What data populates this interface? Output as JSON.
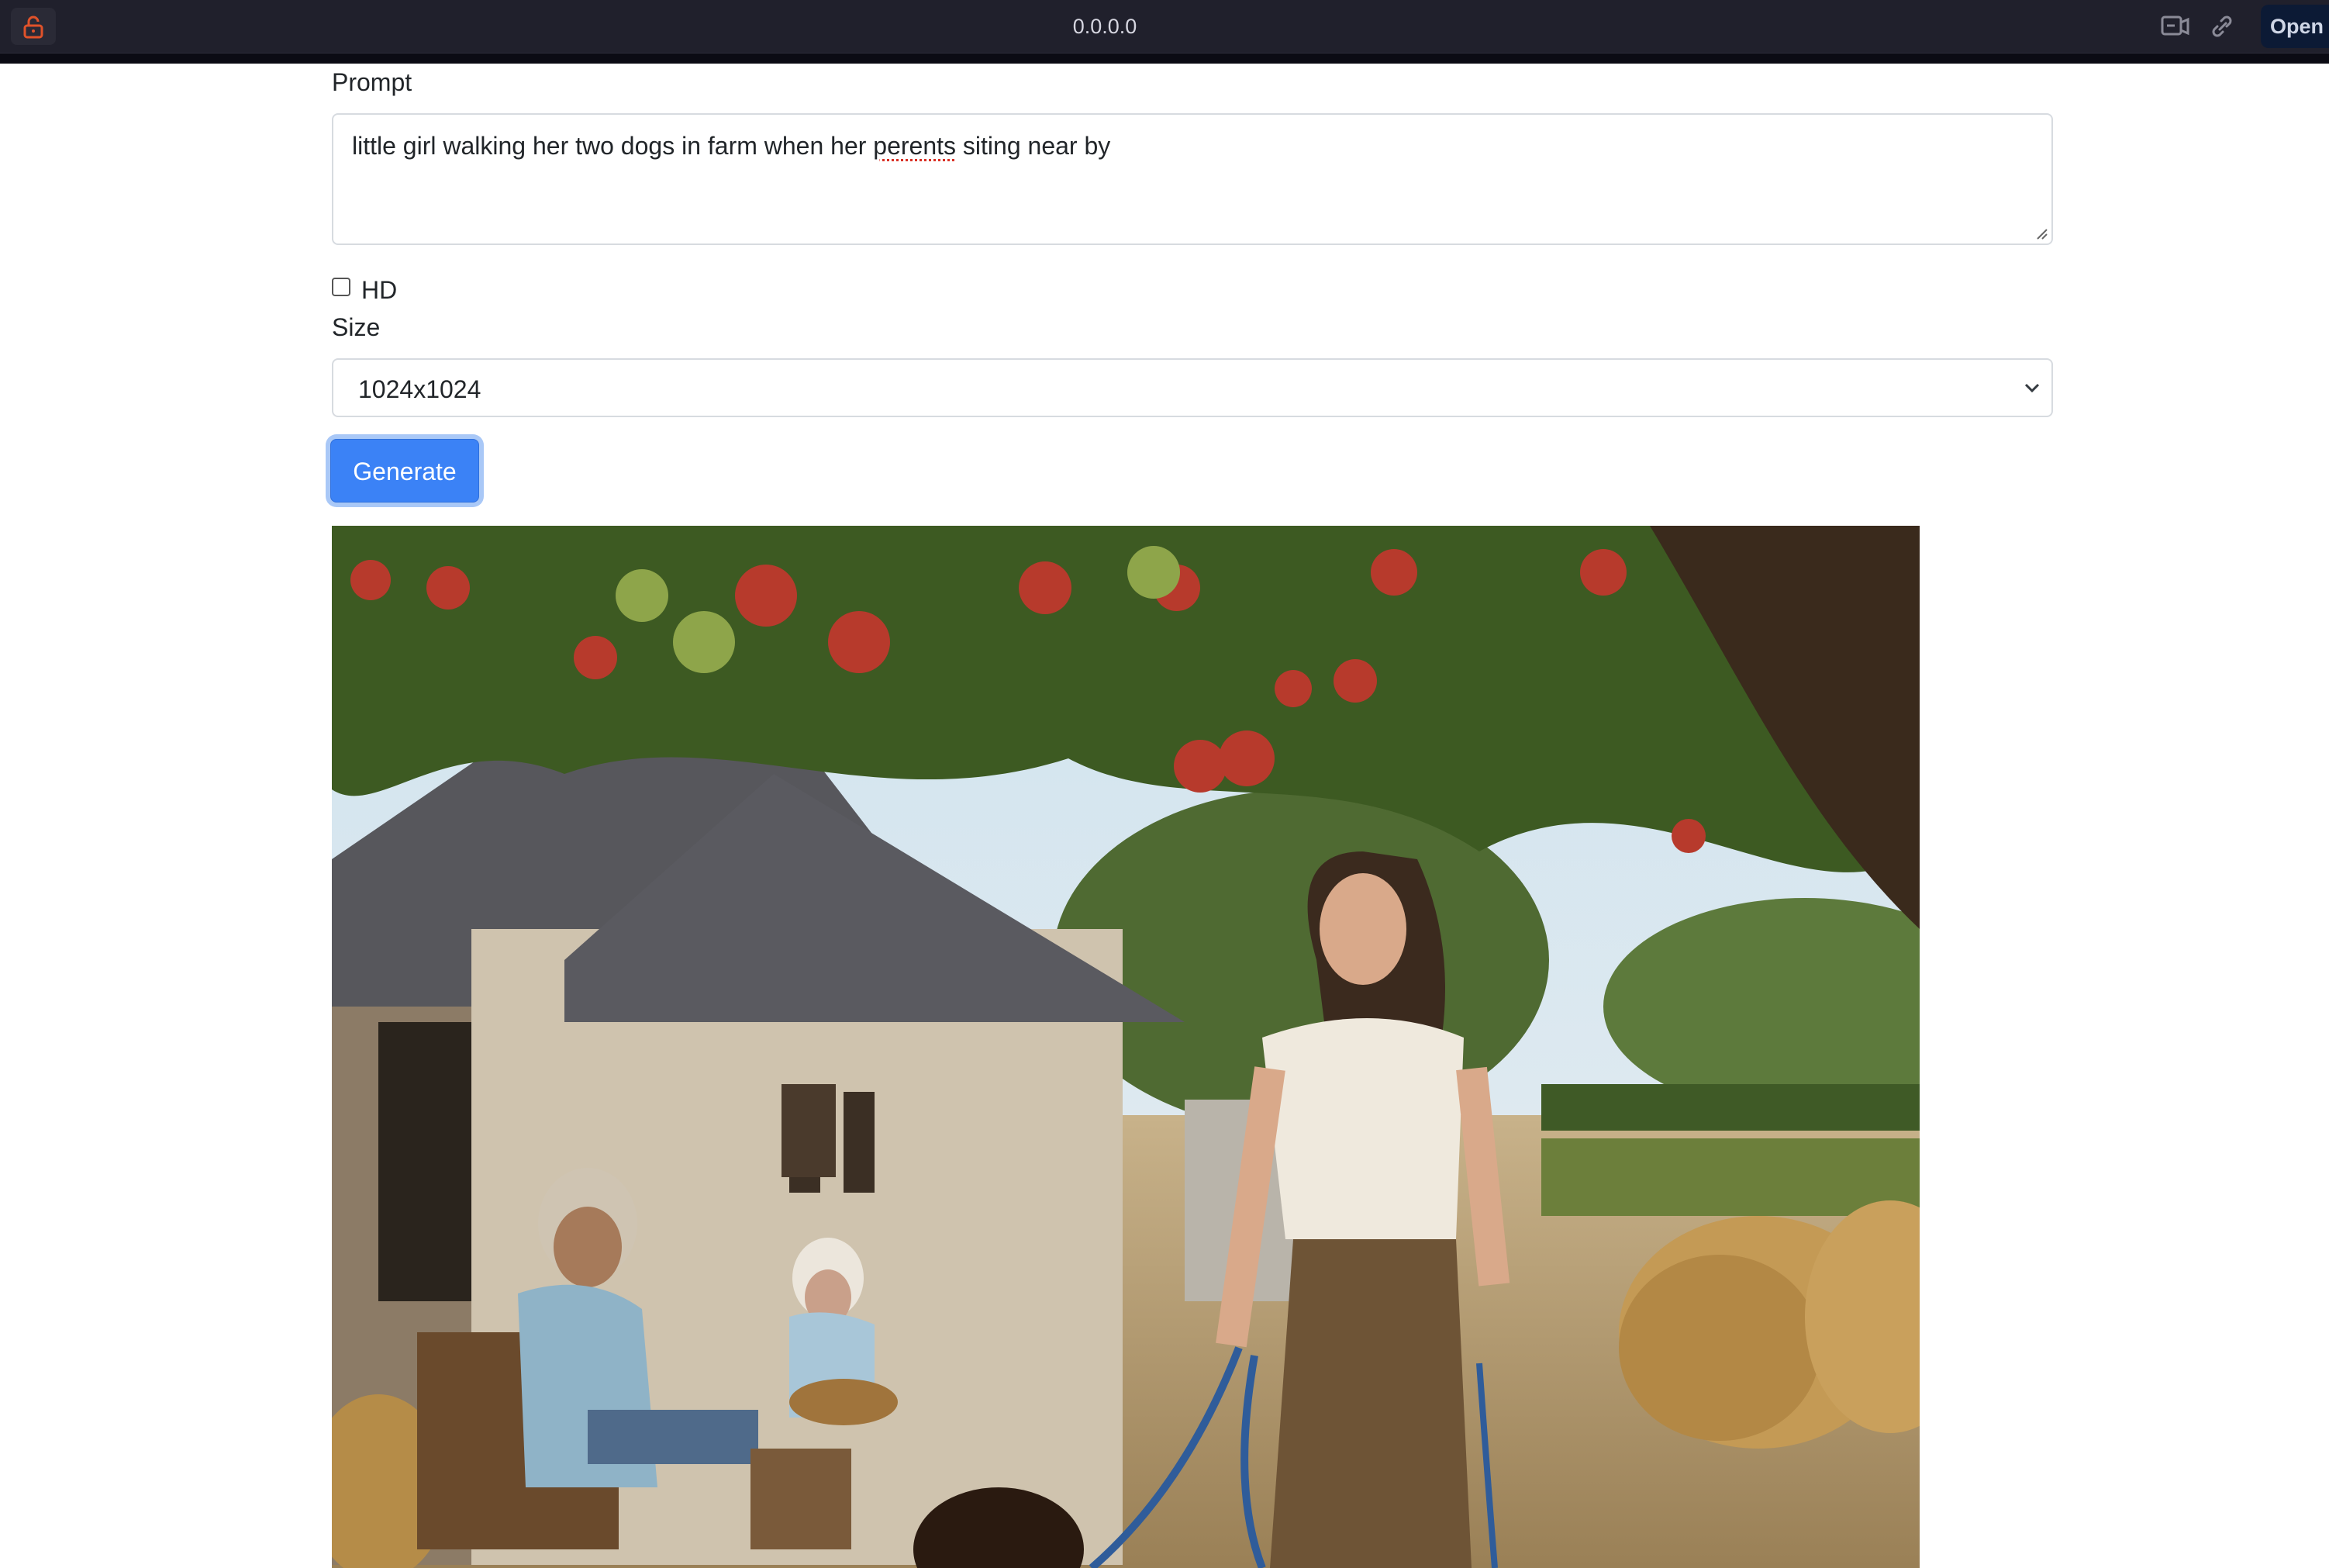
{
  "browser": {
    "url": "0.0.0.0",
    "open_label": "Open in",
    "icons": [
      "lock-icon",
      "screen-share-icon",
      "link-icon"
    ]
  },
  "form": {
    "prompt_label": "Prompt",
    "prompt_value_parts": [
      "little girl walking her two dogs in farm when her ",
      "perents",
      " siting near by"
    ],
    "hd_label": "HD",
    "hd_checked": false,
    "size_label": "Size",
    "size_value": "1024x1024",
    "generate_label": "Generate"
  },
  "colors": {
    "accent": "#3b82f6",
    "lock": "#e0522a"
  }
}
